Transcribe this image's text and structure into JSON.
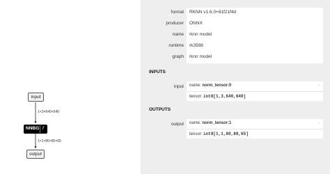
{
  "graph": {
    "input_node": "input",
    "input_edge_label": "1×3×640×640",
    "op_node": {
      "name": "NNBG",
      "flag": "f"
    },
    "output_edge_label": "1×1×80×80×65",
    "output_node": "output"
  },
  "model": {
    "properties": [
      {
        "name": "format",
        "value": "RKNN v1.6.0+81f21f4d"
      },
      {
        "name": "producer",
        "value": "ONNX"
      },
      {
        "name": "name",
        "value": "rknn model"
      },
      {
        "name": "runtime",
        "value": "rk3588"
      },
      {
        "name": "graph",
        "value": "rknn model"
      }
    ],
    "inputs_title": "INPUTS",
    "input": {
      "label": "input",
      "name_prefix": "name: ",
      "name": "norm_tensor:0",
      "tensor_prefix": "tensor: ",
      "tensor": "int8[1,3,640,640]"
    },
    "outputs_title": "OUTPUTS",
    "output": {
      "label": "output",
      "name_prefix": "name: ",
      "name": "norm_tensor:1",
      "tensor_prefix": "tensor: ",
      "tensor": "int8[1,1,80,80,65]"
    }
  },
  "icons": {
    "expand": "minus-icon"
  },
  "colors": {
    "panel_background": "#eeeeee",
    "op_node_fill": "#000000",
    "io_node_fill": "#f2f2f2"
  }
}
